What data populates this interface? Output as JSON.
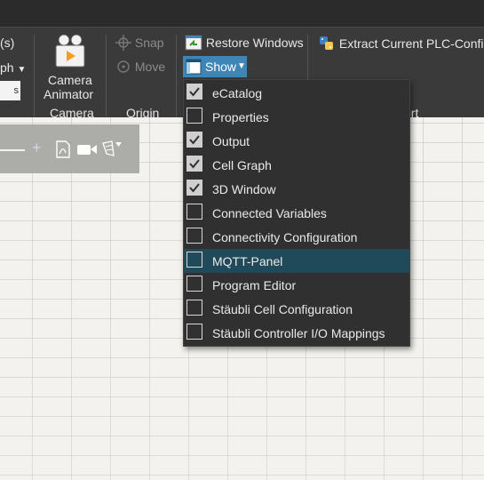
{
  "ribbon": {
    "partial_label_top": "(s)",
    "partial_dropdown": "ph",
    "partial_input_value": "s",
    "camera_button": {
      "label_line1": "Camera",
      "label_line2": "Animator"
    },
    "camera_group_label": "Camera",
    "snap_label": "Snap",
    "move_label": "Move",
    "origin_group_label": "Origin",
    "restore_windows_label": "Restore Windows",
    "show_label": "Show",
    "extract_plc_label": "Extract Current PLC-Config",
    "partial_group_label": "ort"
  },
  "show_menu": {
    "items": [
      {
        "label": "eCatalog",
        "checked": true
      },
      {
        "label": "Properties",
        "checked": false
      },
      {
        "label": "Output",
        "checked": true
      },
      {
        "label": "Cell Graph",
        "checked": true
      },
      {
        "label": "3D Window",
        "checked": true
      },
      {
        "label": "Connected Variables",
        "checked": false
      },
      {
        "label": "Connectivity Configuration",
        "checked": false
      },
      {
        "label": "MQTT-Panel",
        "checked": false,
        "highlighted": true
      },
      {
        "label": "Program Editor",
        "checked": false
      },
      {
        "label": "Stäubli Cell Configuration",
        "checked": false
      },
      {
        "label": "Stäubli Controller I/O Mappings",
        "checked": false
      }
    ]
  },
  "colors": {
    "ribbon_bg": "#3a3a3a",
    "menu_bg": "#303030",
    "menu_highlight": "#204a5a",
    "show_button": "#3f86b8"
  }
}
